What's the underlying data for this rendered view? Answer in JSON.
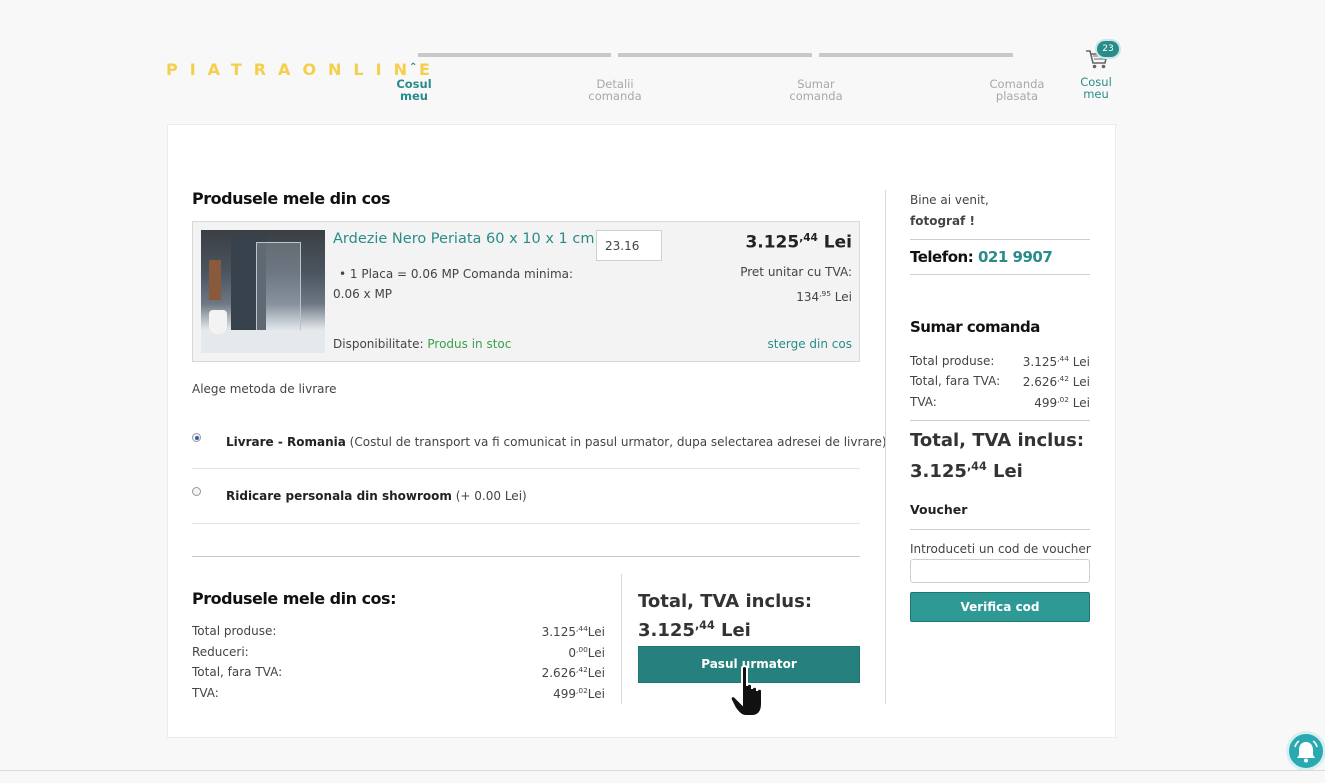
{
  "header": {
    "logo": "PIATRAONLINE",
    "steps": [
      {
        "line1": "Cosul",
        "line2": "meu"
      },
      {
        "line1": "Detalii",
        "line2": "comanda"
      },
      {
        "line1": "Sumar",
        "line2": "comanda"
      },
      {
        "line1": "Comanda",
        "line2": "plasata"
      }
    ],
    "cart": {
      "count": "23",
      "line1": "Cosul",
      "line2": "meu"
    }
  },
  "cart_section": {
    "title": "Produsele mele din cos",
    "product": {
      "name": "Ardezie Nero Periata 60 x 10 x 1 cm",
      "description": "1 Placa = 0.06 MP Comanda minima: 0.06 x MP",
      "quantity": "23.16",
      "price_int": "3.125",
      "price_dec": ",44",
      "currency": "Lei",
      "unit_price_label": "Pret unitar cu TVA:",
      "unit_price_int": "134",
      "unit_price_dec": ",95",
      "availability_label": "Disponibilitate:",
      "availability_value": "Produs in stoc",
      "remove_label": "sterge din cos"
    }
  },
  "shipping": {
    "title": "Alege metoda de livrare",
    "options": [
      {
        "name": "Livrare - Romania",
        "detail": "(Costul de transport va fi comunicat in pasul urmator, dupa selectarea adresei de livrare)",
        "selected": true
      },
      {
        "name": "Ridicare personala din showroom",
        "detail": "(+ 0.00 Lei)",
        "selected": false
      }
    ]
  },
  "bottom_summary": {
    "title": "Produsele mele din cos:",
    "rows": [
      {
        "label": "Total produse:",
        "int": "3.125",
        "dec": ",44",
        "cur": "Lei"
      },
      {
        "label": "Reduceri:",
        "int": "0",
        "dec": ",00",
        "cur": "Lei"
      },
      {
        "label": "Total, fara TVA:",
        "int": "2.626",
        "dec": ",42",
        "cur": "Lei"
      },
      {
        "label": "TVA:",
        "int": "499",
        "dec": ",02",
        "cur": "Lei"
      }
    ],
    "total_label": "Total, TVA inclus:",
    "total_int": "3.125",
    "total_dec": ",44",
    "total_cur": "Lei",
    "next_button": "Pasul urmator"
  },
  "sidebar": {
    "welcome": "Bine ai venit,",
    "user": "fotograf !",
    "phone_label": "Telefon:",
    "phone": "021 9907",
    "summary_title": "Sumar comanda",
    "rows": [
      {
        "label": "Total produse:",
        "int": "3.125",
        "dec": ",44",
        "cur": "Lei"
      },
      {
        "label": "Total, fara TVA:",
        "int": "2.626",
        "dec": ",42",
        "cur": "Lei"
      },
      {
        "label": "TVA:",
        "int": "499",
        "dec": ",02",
        "cur": "Lei"
      }
    ],
    "total_label": "Total, TVA inclus:",
    "total_int": "3.125",
    "total_dec": ",44",
    "total_cur": "Lei",
    "voucher_title": "Voucher",
    "voucher_label": "Introduceti un cod de voucher",
    "voucher_value": "",
    "voucher_button": "Verifica cod"
  },
  "colors": {
    "accent": "#2a8c8a",
    "logo": "#f5cf4a",
    "in_stock": "#3aa14a"
  }
}
